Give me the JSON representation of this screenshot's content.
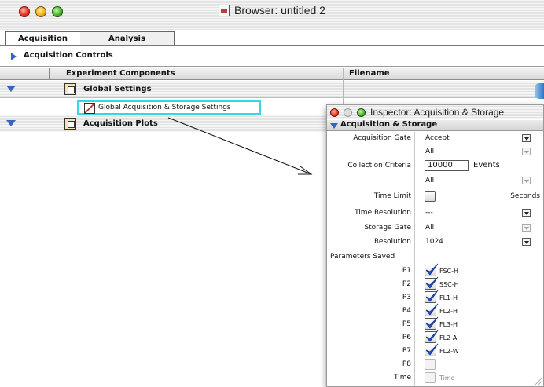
{
  "browser": {
    "title": "Browser: untitled 2",
    "tabs": [
      {
        "label": "Acquisition",
        "active": true
      },
      {
        "label": "Analysis",
        "active": false
      }
    ],
    "controls_label": "Acquisition Controls",
    "columns": {
      "components": "Experiment Components",
      "filename": "Filename"
    },
    "rows": [
      {
        "label": "Global Settings",
        "expanded": true
      },
      {
        "label": "Global Acquisition & Storage Settings",
        "selected": true
      },
      {
        "label": "Acquisition Plots",
        "expanded": true
      }
    ]
  },
  "inspector": {
    "title": "Inspector: Acquisition & Storage",
    "section": "Acquisition & Storage",
    "fields": {
      "acquisition_gate": {
        "label": "Acquisition Gate",
        "value": "Accept",
        "sub_value": "All"
      },
      "collection_criteria": {
        "label": "Collection Criteria",
        "value": "10000",
        "unit": "Events",
        "sub_value": "All"
      },
      "time_limit": {
        "label": "Time Limit",
        "unit": "Seconds",
        "checked": false
      },
      "time_resolution": {
        "label": "Time Resolution",
        "value": "---"
      },
      "storage_gate": {
        "label": "Storage Gate",
        "value": "All"
      },
      "resolution": {
        "label": "Resolution",
        "value": "1024"
      }
    },
    "parameters_label": "Parameters Saved",
    "parameters": [
      {
        "label": "P1",
        "name": "FSC-H",
        "checked": true
      },
      {
        "label": "P2",
        "name": "SSC-H",
        "checked": true
      },
      {
        "label": "P3",
        "name": "FL1-H",
        "checked": true
      },
      {
        "label": "P4",
        "name": "FL2-H",
        "checked": true
      },
      {
        "label": "P5",
        "name": "FL3-H",
        "checked": true
      },
      {
        "label": "P6",
        "name": "FL2-A",
        "checked": true
      },
      {
        "label": "P7",
        "name": "FL2-W",
        "checked": true
      },
      {
        "label": "P8",
        "name": "",
        "checked": false
      },
      {
        "label": "Time",
        "name": "Time",
        "checked": false
      }
    ]
  },
  "colors": {
    "highlight": "#38d6e2",
    "disclosure": "#3a62c0",
    "check": "#2255cc"
  },
  "icons": [
    "close-icon",
    "minimize-icon",
    "zoom-icon",
    "document-icon",
    "disclosure-triangle-icon",
    "folder-icon",
    "settings-document-icon",
    "dropdown-arrow-icon",
    "checkmark-icon",
    "resize-grip-icon"
  ]
}
